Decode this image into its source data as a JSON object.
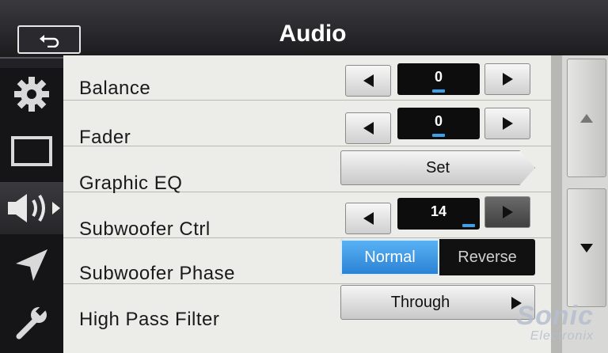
{
  "header": {
    "title": "Audio",
    "back_icon": "back-arrow-icon"
  },
  "sidebar": {
    "items": [
      {
        "icon": "gear-icon"
      },
      {
        "icon": "screen-icon"
      },
      {
        "icon": "speaker-icon",
        "active": true
      },
      {
        "icon": "navigation-arrow-icon"
      },
      {
        "icon": "wrench-icon"
      }
    ]
  },
  "rows": {
    "balance": {
      "label": "Balance",
      "value": "0"
    },
    "fader": {
      "label": "Fader",
      "value": "0"
    },
    "graphic_eq": {
      "label": "Graphic EQ",
      "button": "Set"
    },
    "subwoofer_ctrl": {
      "label": "Subwoofer Ctrl",
      "value": "14"
    },
    "subwoofer_phase": {
      "label": "Subwoofer Phase",
      "options": [
        "Normal",
        "Reverse"
      ],
      "selected": "Normal"
    },
    "high_pass_filter": {
      "label": "High Pass Filter",
      "value": "Through"
    }
  },
  "watermark": {
    "brand": "Sonic",
    "sub": "Electronix"
  },
  "colors": {
    "accent": "#3aa0e8",
    "selected": "#2a82d4"
  }
}
